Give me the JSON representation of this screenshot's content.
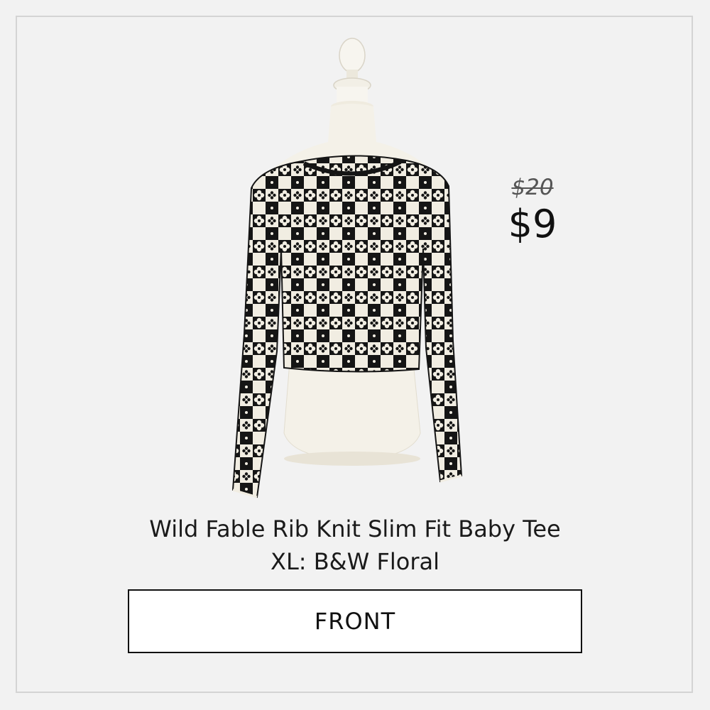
{
  "product": {
    "title": "Wild Fable Rib Knit Slim Fit Baby Tee",
    "variant": "XL: B&W Floral",
    "image_alt": "Black and white checkered floral rib knit long sleeve cropped tee on a dress form"
  },
  "pricing": {
    "original_price": "$20",
    "sale_price": "$9"
  },
  "view": {
    "label": "FRONT"
  },
  "colors": {
    "background": "#f2f2f2",
    "border": "#d4d4d4",
    "text": "#111111"
  }
}
